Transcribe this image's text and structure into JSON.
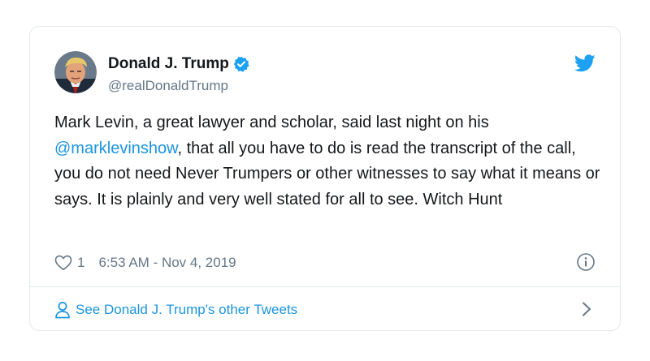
{
  "author": {
    "name": "Donald J. Trump",
    "handle": "@realDonaldTrump",
    "verified": true,
    "avatar_icon": "profile-photo"
  },
  "tweet": {
    "text_part1": "Mark Levin, a great lawyer and scholar, said last night on his ",
    "mention": "@marklevinshow",
    "text_part2": ", that all you have to do is read the transcript of the call, you do not need Never Trumpers or other witnesses to say what it means or says. It is plainly and very well stated for all to see. Witch Hunt"
  },
  "meta": {
    "likes": "1",
    "timestamp": "6:53 AM - Nov 4, 2019"
  },
  "footer": {
    "link_text": "See Donald J. Trump's other Tweets"
  },
  "colors": {
    "accent": "#1b95e0",
    "muted": "#657786",
    "border": "#e1e8ed",
    "verified_badge": "#1da1f2"
  },
  "icons": [
    "twitter-bird-icon",
    "verified-badge-icon",
    "heart-icon",
    "info-icon",
    "person-icon",
    "chevron-right-icon"
  ]
}
